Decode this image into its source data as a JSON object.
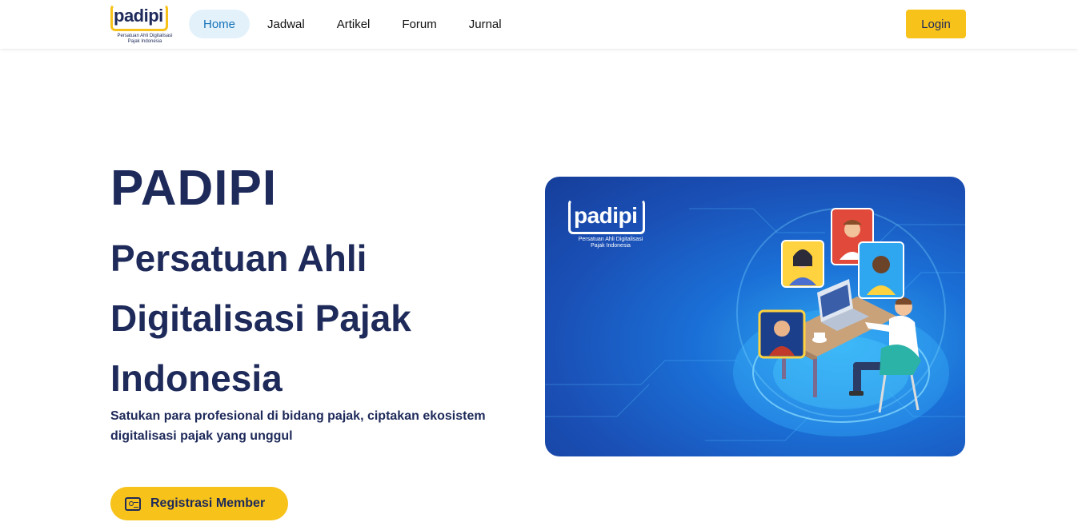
{
  "header": {
    "logo": {
      "word": "padipi",
      "subtitle": "Persatuan Ahli Digitalisasi Pajak Indonesia"
    },
    "nav": [
      {
        "label": "Home",
        "active": true
      },
      {
        "label": "Jadwal",
        "active": false
      },
      {
        "label": "Artikel",
        "active": false
      },
      {
        "label": "Forum",
        "active": false
      },
      {
        "label": "Jurnal",
        "active": false
      }
    ],
    "login_label": "Login"
  },
  "hero": {
    "title": "PADIPI",
    "subtitle": "Persatuan Ahli Digitalisasi Pajak Indonesia",
    "description": "Satukan para profesional di bidang pajak, ciptakan ekosistem digitalisasi pajak yang unggul",
    "register_label": "Registrasi Member",
    "register_icon": "id-card-icon",
    "image": {
      "logo_word": "padipi",
      "logo_subtitle": "Persatuan Ahli Digitalisasi Pajak Indonesia"
    }
  },
  "colors": {
    "brand_navy": "#1e2a5a",
    "accent_yellow": "#f7c21a",
    "nav_active_bg": "#e3f1fb",
    "nav_active_text": "#1673b8",
    "hero_blue": "#1a6fd6"
  }
}
